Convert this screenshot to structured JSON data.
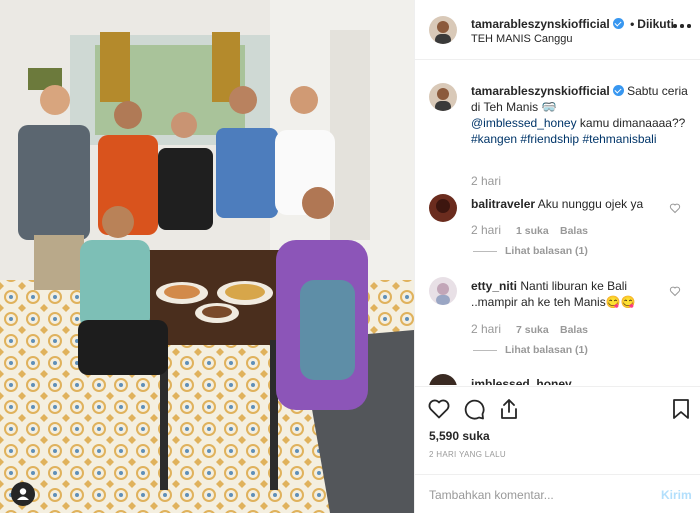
{
  "post": {
    "username": "tamarableszynskiofficial",
    "follow_dot": "•",
    "follow_status": "Diikuti",
    "location": "TEH MANIS Canggu",
    "caption_text": "Sabtu ceria di Teh Manis",
    "caption_mention": "@imblessed_honey",
    "caption_text2": "kamu dimanaaaa??",
    "caption_tags": [
      "#kangen",
      "#friendship",
      "#tehmanisbali"
    ],
    "time": "2 hari"
  },
  "comments": [
    {
      "user": "balitraveler",
      "text": "Aku nunggu ojek ya",
      "time": "2 hari",
      "likes": "1 suka",
      "reply": "Balas",
      "view_replies": "Lihat balasan (1)"
    },
    {
      "user": "etty_niti",
      "text": "Nanti liburan ke Bali ..mampir ah ke teh Manis😋😋",
      "time": "2 hari",
      "likes": "7 suka",
      "reply": "Balas",
      "view_replies": "Lihat balasan (1)"
    },
    {
      "user": "imblessed_honey"
    }
  ],
  "footer": {
    "likes": "5,590 suka",
    "ago": "2 HARI YANG LALU",
    "comment_placeholder": "Tambahkan komentar...",
    "post_button": "Kirim"
  },
  "colors": {
    "verified": "#3897f0",
    "link": "#003569",
    "muted": "#999999",
    "post_button": "#b2dffc"
  },
  "icons": [
    "verified-badge-icon",
    "more-options-icon",
    "like-heart-icon",
    "comment-icon",
    "share-icon",
    "save-bookmark-icon",
    "user-tag-icon",
    "comment-heart-icon"
  ]
}
